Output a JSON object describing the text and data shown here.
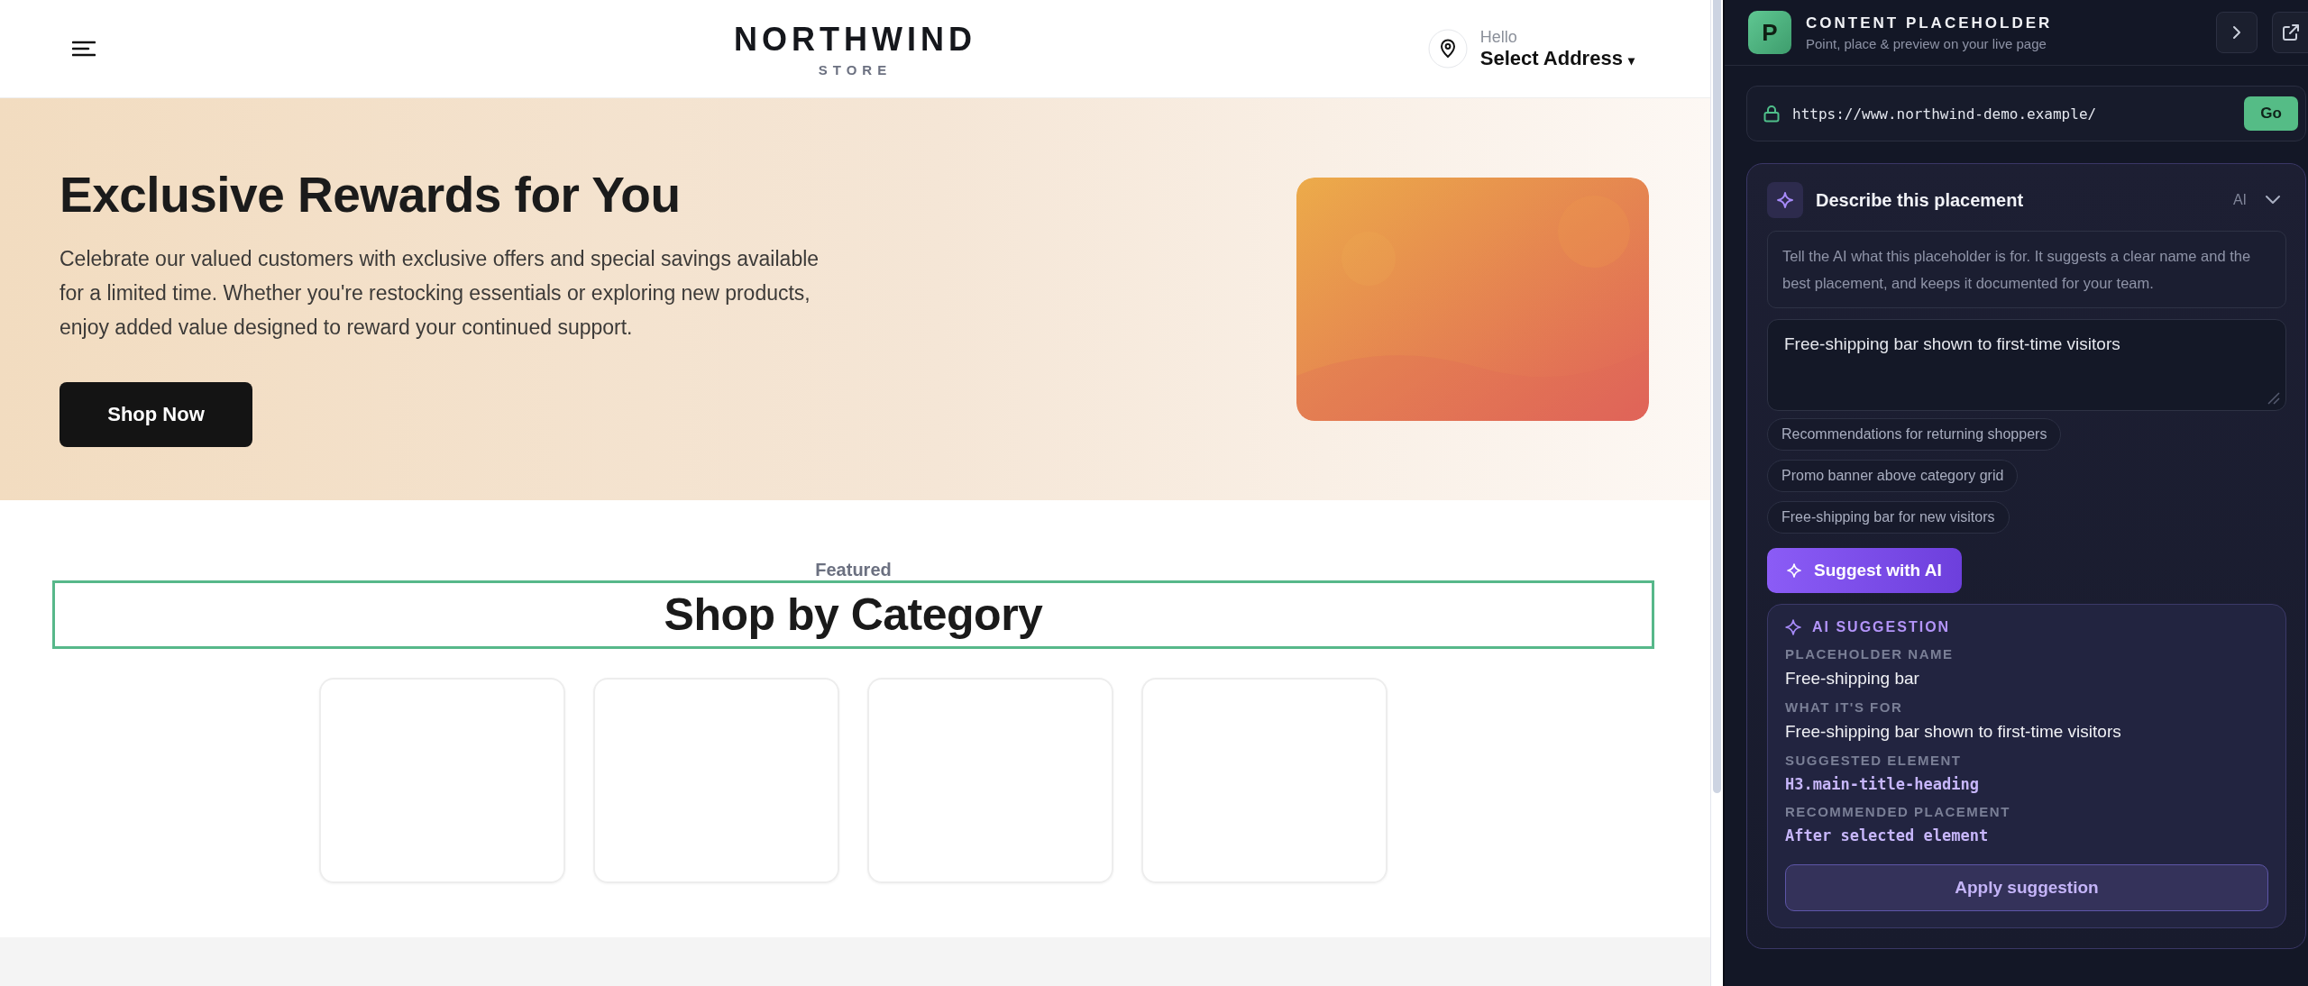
{
  "store_header": {
    "logo": "NORTHWIND",
    "logo_sub": "STORE",
    "greeting": "Hello",
    "address": "Select Address",
    "address_caret": "▾"
  },
  "hero": {
    "title": "Exclusive Rewards for You",
    "text": "Celebrate our valued customers with exclusive offers and special savings available for a limited time. Whether you're restocking essentials or exploring new products, enjoy added value designed to reward your continued support.",
    "button": "Shop Now"
  },
  "featured": {
    "eyebrow": "Featured",
    "heading": "Shop by Category",
    "heading_selected": true,
    "category_cards": [
      {
        "kind": "empty"
      },
      {
        "kind": "empty"
      },
      {
        "kind": "empty"
      },
      {
        "kind": "empty"
      }
    ]
  },
  "panel": {
    "app_letter": "P",
    "title": "CONTENT PLACEHOLDER",
    "subtitle": "Point, place & preview on your live page",
    "url": "https://www.northwind-demo.example/",
    "go_button": "Go",
    "describe": {
      "title": "Describe this placement",
      "badge": "AI",
      "expanded": true,
      "info": "Tell the AI what this placeholder is for. It suggests a clear name and the best placement, and keeps it documented for your team.",
      "description": "Free-shipping bar shown to first-time visitors",
      "chips": [
        "Recommendations for returning shoppers",
        "Promo banner above category grid",
        "Free-shipping bar for new visitors"
      ],
      "suggest_button": "Suggest with AI",
      "suggestion": {
        "heading": "AI SUGGESTION",
        "fields": [
          {
            "label": "PLACEHOLDER NAME",
            "value": "Free-shipping bar",
            "kind": "text"
          },
          {
            "label": "WHAT IT'S FOR",
            "value": "Free-shipping bar shown to first-time visitors",
            "kind": "text"
          },
          {
            "label": "SUGGESTED ELEMENT",
            "value": "H3.main-title-heading",
            "kind": "code"
          },
          {
            "label": "RECOMMENDED PLACEMENT",
            "value": "After selected element",
            "kind": "code"
          }
        ],
        "apply_button": "Apply suggestion"
      }
    }
  }
}
